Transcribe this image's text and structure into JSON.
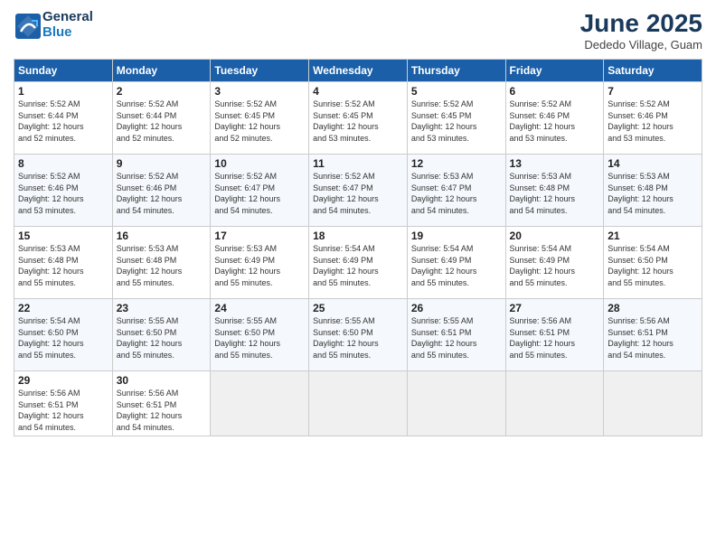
{
  "logo": {
    "line1": "General",
    "line2": "Blue"
  },
  "title": "June 2025",
  "location": "Dededo Village, Guam",
  "days_header": [
    "Sunday",
    "Monday",
    "Tuesday",
    "Wednesday",
    "Thursday",
    "Friday",
    "Saturday"
  ],
  "weeks": [
    [
      {
        "day": "1",
        "info": "Sunrise: 5:52 AM\nSunset: 6:44 PM\nDaylight: 12 hours\nand 52 minutes."
      },
      {
        "day": "2",
        "info": "Sunrise: 5:52 AM\nSunset: 6:44 PM\nDaylight: 12 hours\nand 52 minutes."
      },
      {
        "day": "3",
        "info": "Sunrise: 5:52 AM\nSunset: 6:45 PM\nDaylight: 12 hours\nand 52 minutes."
      },
      {
        "day": "4",
        "info": "Sunrise: 5:52 AM\nSunset: 6:45 PM\nDaylight: 12 hours\nand 53 minutes."
      },
      {
        "day": "5",
        "info": "Sunrise: 5:52 AM\nSunset: 6:45 PM\nDaylight: 12 hours\nand 53 minutes."
      },
      {
        "day": "6",
        "info": "Sunrise: 5:52 AM\nSunset: 6:46 PM\nDaylight: 12 hours\nand 53 minutes."
      },
      {
        "day": "7",
        "info": "Sunrise: 5:52 AM\nSunset: 6:46 PM\nDaylight: 12 hours\nand 53 minutes."
      }
    ],
    [
      {
        "day": "8",
        "info": "Sunrise: 5:52 AM\nSunset: 6:46 PM\nDaylight: 12 hours\nand 53 minutes."
      },
      {
        "day": "9",
        "info": "Sunrise: 5:52 AM\nSunset: 6:46 PM\nDaylight: 12 hours\nand 54 minutes."
      },
      {
        "day": "10",
        "info": "Sunrise: 5:52 AM\nSunset: 6:47 PM\nDaylight: 12 hours\nand 54 minutes."
      },
      {
        "day": "11",
        "info": "Sunrise: 5:52 AM\nSunset: 6:47 PM\nDaylight: 12 hours\nand 54 minutes."
      },
      {
        "day": "12",
        "info": "Sunrise: 5:53 AM\nSunset: 6:47 PM\nDaylight: 12 hours\nand 54 minutes."
      },
      {
        "day": "13",
        "info": "Sunrise: 5:53 AM\nSunset: 6:48 PM\nDaylight: 12 hours\nand 54 minutes."
      },
      {
        "day": "14",
        "info": "Sunrise: 5:53 AM\nSunset: 6:48 PM\nDaylight: 12 hours\nand 54 minutes."
      }
    ],
    [
      {
        "day": "15",
        "info": "Sunrise: 5:53 AM\nSunset: 6:48 PM\nDaylight: 12 hours\nand 55 minutes."
      },
      {
        "day": "16",
        "info": "Sunrise: 5:53 AM\nSunset: 6:48 PM\nDaylight: 12 hours\nand 55 minutes."
      },
      {
        "day": "17",
        "info": "Sunrise: 5:53 AM\nSunset: 6:49 PM\nDaylight: 12 hours\nand 55 minutes."
      },
      {
        "day": "18",
        "info": "Sunrise: 5:54 AM\nSunset: 6:49 PM\nDaylight: 12 hours\nand 55 minutes."
      },
      {
        "day": "19",
        "info": "Sunrise: 5:54 AM\nSunset: 6:49 PM\nDaylight: 12 hours\nand 55 minutes."
      },
      {
        "day": "20",
        "info": "Sunrise: 5:54 AM\nSunset: 6:49 PM\nDaylight: 12 hours\nand 55 minutes."
      },
      {
        "day": "21",
        "info": "Sunrise: 5:54 AM\nSunset: 6:50 PM\nDaylight: 12 hours\nand 55 minutes."
      }
    ],
    [
      {
        "day": "22",
        "info": "Sunrise: 5:54 AM\nSunset: 6:50 PM\nDaylight: 12 hours\nand 55 minutes."
      },
      {
        "day": "23",
        "info": "Sunrise: 5:55 AM\nSunset: 6:50 PM\nDaylight: 12 hours\nand 55 minutes."
      },
      {
        "day": "24",
        "info": "Sunrise: 5:55 AM\nSunset: 6:50 PM\nDaylight: 12 hours\nand 55 minutes."
      },
      {
        "day": "25",
        "info": "Sunrise: 5:55 AM\nSunset: 6:50 PM\nDaylight: 12 hours\nand 55 minutes."
      },
      {
        "day": "26",
        "info": "Sunrise: 5:55 AM\nSunset: 6:51 PM\nDaylight: 12 hours\nand 55 minutes."
      },
      {
        "day": "27",
        "info": "Sunrise: 5:56 AM\nSunset: 6:51 PM\nDaylight: 12 hours\nand 55 minutes."
      },
      {
        "day": "28",
        "info": "Sunrise: 5:56 AM\nSunset: 6:51 PM\nDaylight: 12 hours\nand 54 minutes."
      }
    ],
    [
      {
        "day": "29",
        "info": "Sunrise: 5:56 AM\nSunset: 6:51 PM\nDaylight: 12 hours\nand 54 minutes."
      },
      {
        "day": "30",
        "info": "Sunrise: 5:56 AM\nSunset: 6:51 PM\nDaylight: 12 hours\nand 54 minutes."
      },
      null,
      null,
      null,
      null,
      null
    ]
  ]
}
